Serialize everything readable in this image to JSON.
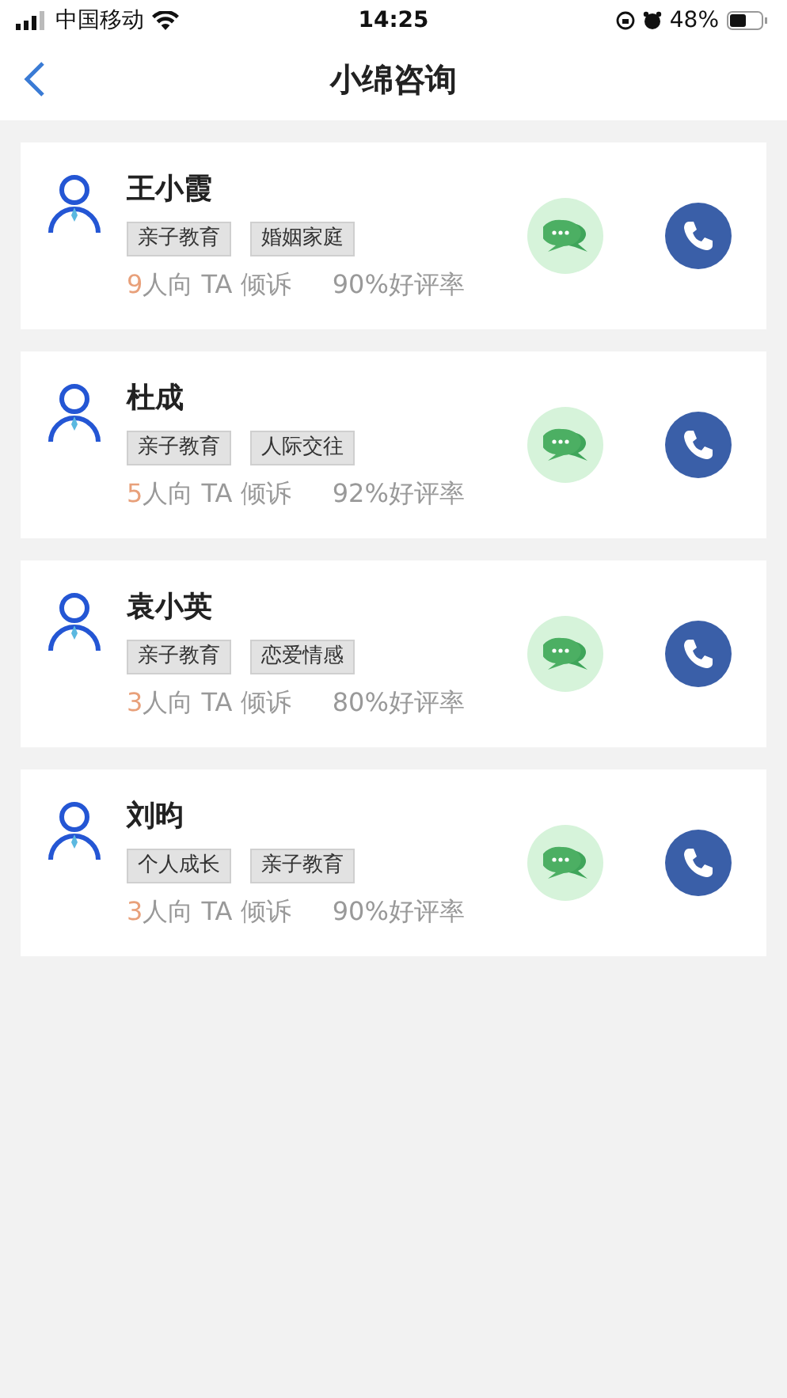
{
  "status_bar": {
    "carrier": "中国移动",
    "time": "14:25",
    "battery": "48%"
  },
  "nav": {
    "title": "小绵咨询"
  },
  "counselors": [
    {
      "name": "王小霞",
      "tags": [
        "亲子教育",
        "婚姻家庭"
      ],
      "count": "9",
      "count_text": "人向 TA 倾诉",
      "rating": "90%好评率"
    },
    {
      "name": "杜成",
      "tags": [
        "亲子教育",
        "人际交往"
      ],
      "count": "5",
      "count_text": "人向 TA 倾诉",
      "rating": "92%好评率"
    },
    {
      "name": "袁小英",
      "tags": [
        "亲子教育",
        "恋爱情感"
      ],
      "count": "3",
      "count_text": "人向 TA 倾诉",
      "rating": "80%好评率"
    },
    {
      "name": "刘昀",
      "tags": [
        "个人成长",
        "亲子教育"
      ],
      "count": "3",
      "count_text": "人向 TA 倾诉",
      "rating": "90%好评率"
    }
  ]
}
